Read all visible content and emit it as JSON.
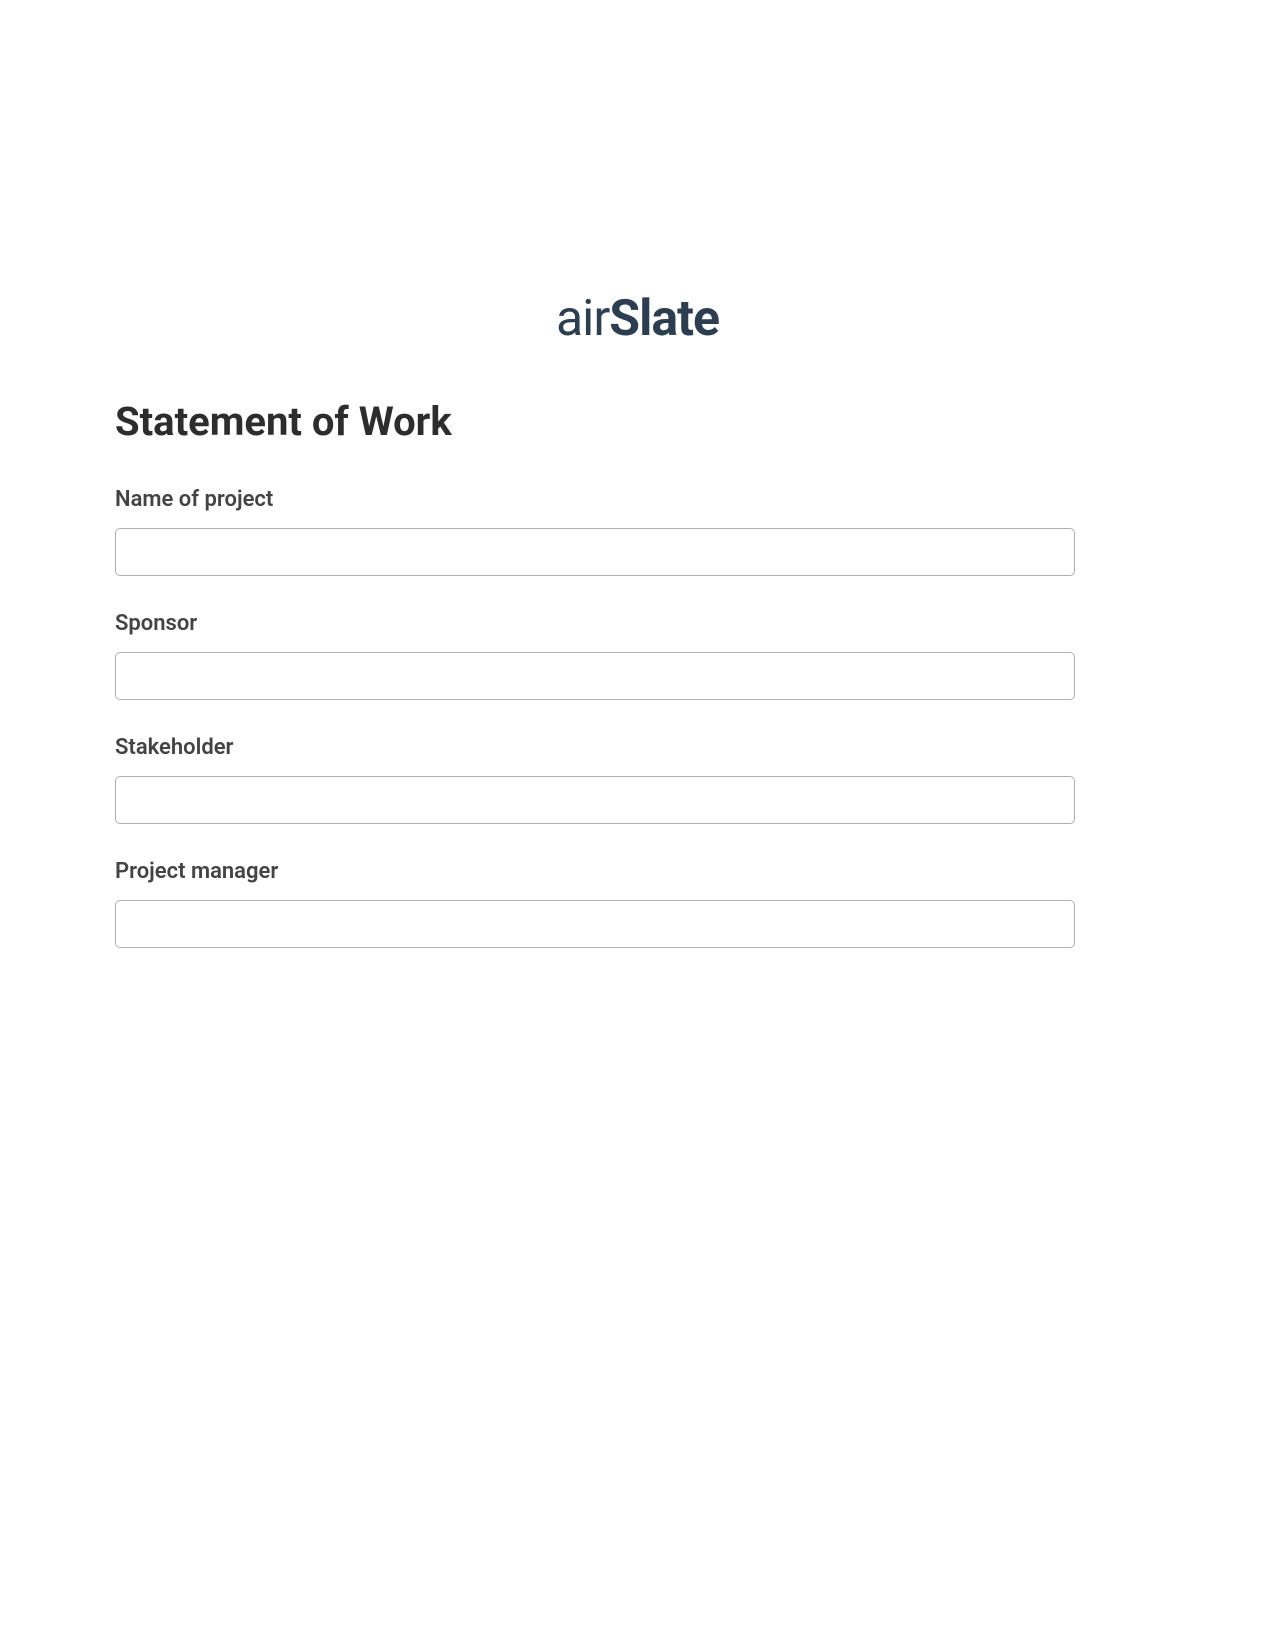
{
  "logo": {
    "prefix": "air",
    "suffix": "Slate"
  },
  "title": "Statement of Work",
  "fields": [
    {
      "label": "Name of project",
      "value": ""
    },
    {
      "label": "Sponsor",
      "value": ""
    },
    {
      "label": "Stakeholder",
      "value": ""
    },
    {
      "label": "Project manager",
      "value": ""
    }
  ]
}
